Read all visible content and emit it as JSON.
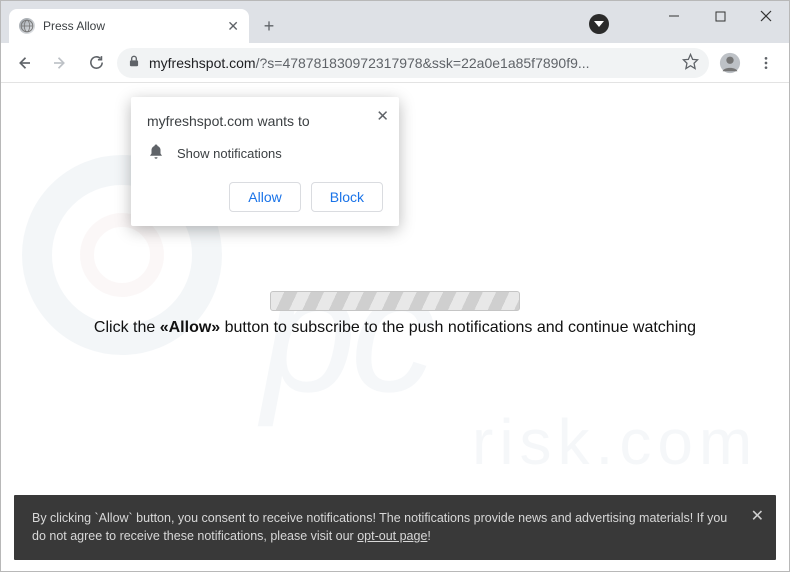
{
  "window": {
    "tab_title": "Press Allow"
  },
  "url": {
    "host": "myfreshspot.com",
    "path": "/?s=478781830972317978&ssk=22a0e1a85f7890f9..."
  },
  "permission": {
    "title_prefix": "myfreshspot.com",
    "title_suffix": " wants to",
    "line": "Show notifications",
    "allow": "Allow",
    "block": "Block"
  },
  "page": {
    "instruction_pre": "Click the ",
    "instruction_strong": "«Allow»",
    "instruction_post": " button to subscribe to the push notifications and continue watching"
  },
  "footer": {
    "l1_pre": "By clicking `Allow` button, you consent to receive notifications! The notifications provide news and ",
    "l2_pre": "advertising materials! If you do not agree to receive these notifications, please visit our ",
    "link": "opt-out page",
    "l2_post": "!"
  },
  "watermark": {
    "big": "pc",
    "sub": "risk.com"
  }
}
